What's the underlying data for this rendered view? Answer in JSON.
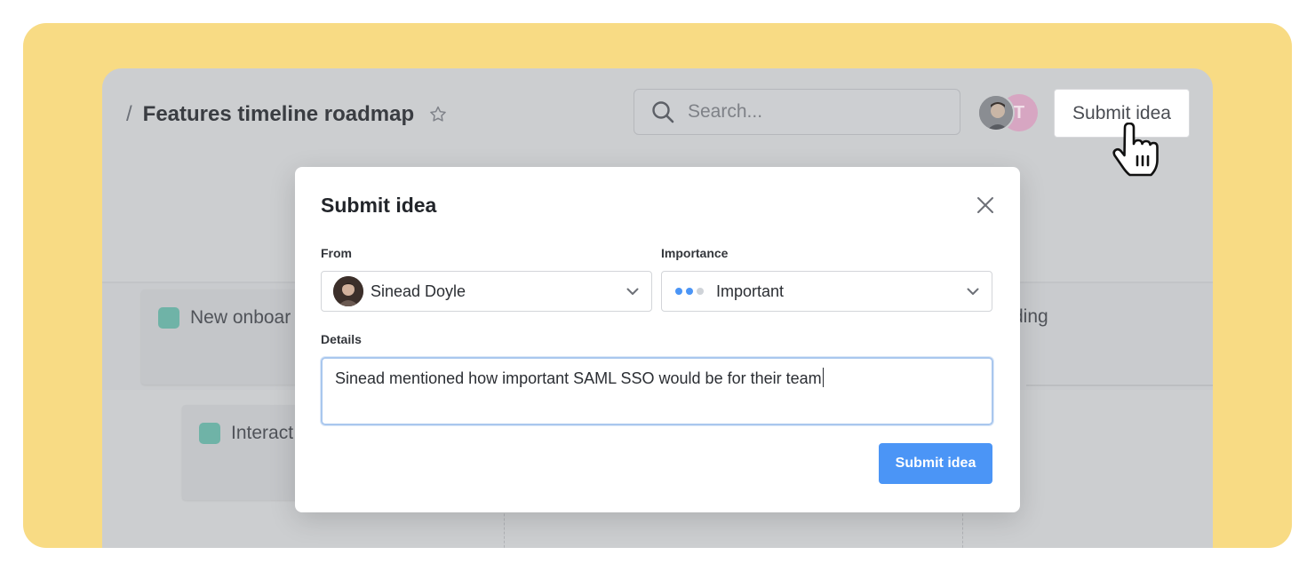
{
  "header": {
    "separator": "/",
    "title": "Features timeline roadmap",
    "search_placeholder": "Search...",
    "avatar_initial": "T",
    "submit_label": "Submit idea"
  },
  "board": {
    "cards": [
      {
        "text": "New onboar"
      },
      {
        "text": "Interact"
      }
    ],
    "right_text": "ding"
  },
  "modal": {
    "title": "Submit idea",
    "from_label": "From",
    "from_value": "Sinead Doyle",
    "importance_label": "Importance",
    "importance_value": "Important",
    "details_label": "Details",
    "details_value": "Sinead mentioned how important SAML SSO would be for their team",
    "submit_label": "Submit idea"
  },
  "colors": {
    "accent": "#4b95f6",
    "background_frame": "#f8db84",
    "card_tag": "#6fb3a7",
    "importance_on": "#4b95f6",
    "importance_off": "#cfd3d8"
  },
  "icons": {
    "search": "search-icon",
    "star": "star-icon",
    "close": "close-icon",
    "chevron": "chevron-down-icon",
    "cursor": "hand-pointer-icon"
  }
}
